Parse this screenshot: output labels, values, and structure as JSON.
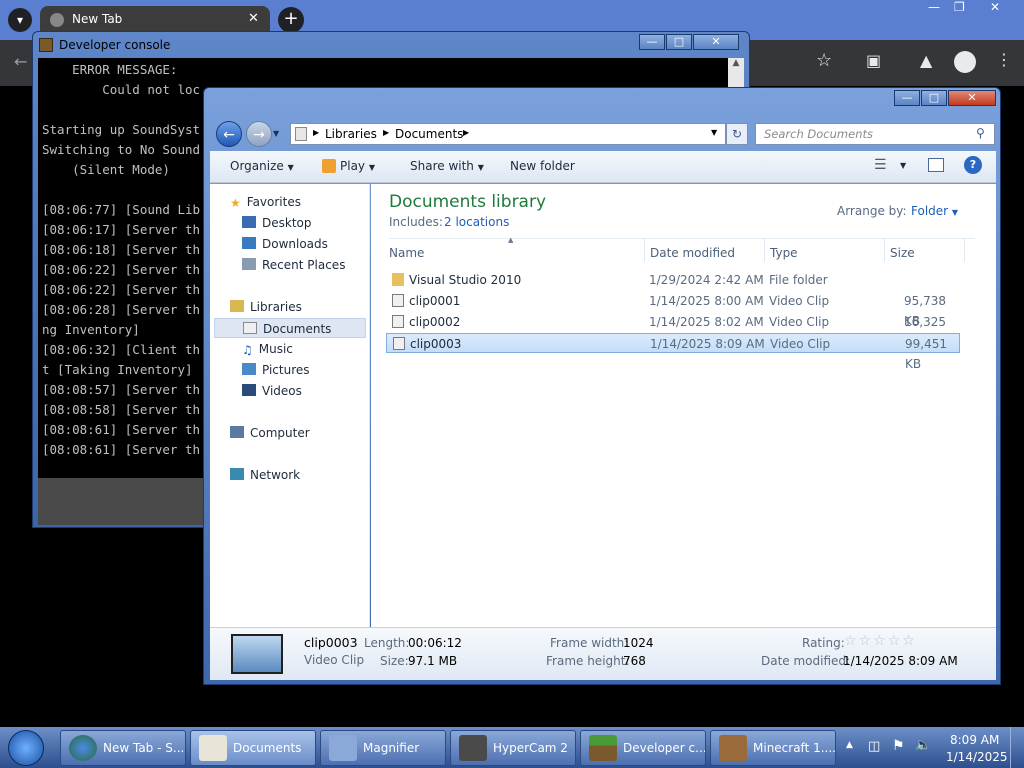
{
  "chrome": {
    "tab_title": "New Tab"
  },
  "console": {
    "title": "Developer console",
    "lines": [
      "    ERROR MESSAGE:",
      "        Could not loc",
      "",
      "Starting up SoundSyst",
      "Switching to No Sound",
      "    (Silent Mode)",
      "",
      "[08:06:77] [Sound Lib",
      "[08:06:17] [Server th",
      "[08:06:18] [Server th",
      "[08:06:22] [Server th",
      "[08:06:22] [Server th",
      "[08:06:28] [Server th",
      "ng Inventory]",
      "[08:06:32] [Client th",
      "t [Taking Inventory]",
      "[08:08:57] [Server th",
      "[08:08:58] [Server th",
      "[08:08:61] [Server th",
      "[08:08:61] [Server th"
    ]
  },
  "explorer": {
    "breadcrumb": [
      "Libraries",
      "Documents"
    ],
    "search_placeholder": "Search Documents",
    "toolbar": {
      "organize": "Organize",
      "play": "Play",
      "share": "Share with",
      "new_folder": "New folder"
    },
    "nav": {
      "favorites": "Favorites",
      "fav_items": [
        "Desktop",
        "Downloads",
        "Recent Places"
      ],
      "libraries": "Libraries",
      "lib_items": [
        "Documents",
        "Music",
        "Pictures",
        "Videos"
      ],
      "computer": "Computer",
      "network": "Network"
    },
    "library_title": "Documents library",
    "includes_label": "Includes:",
    "includes_link": "2 locations",
    "arrange_label": "Arrange by:",
    "arrange_value": "Folder",
    "columns": {
      "name": "Name",
      "date": "Date modified",
      "type": "Type",
      "size": "Size"
    },
    "files": [
      {
        "name": "Visual Studio 2010",
        "date": "1/29/2024 2:42 AM",
        "type": "File folder",
        "size": ""
      },
      {
        "name": "clip0001",
        "date": "1/14/2025 8:00 AM",
        "type": "Video Clip",
        "size": "95,738 KB"
      },
      {
        "name": "clip0002",
        "date": "1/14/2025 8:02 AM",
        "type": "Video Clip",
        "size": "16,325 KB"
      },
      {
        "name": "clip0003",
        "date": "1/14/2025 8:09 AM",
        "type": "Video Clip",
        "size": "99,451 KB"
      }
    ],
    "details": {
      "name": "clip0003",
      "kind": "Video Clip",
      "length_label": "Length:",
      "length": "00:06:12",
      "size_label": "Size:",
      "size": "97.1 MB",
      "fw_label": "Frame width:",
      "fw": "1024",
      "fh_label": "Frame height:",
      "fh": "768",
      "rating_label": "Rating:",
      "dm_label": "Date modified:",
      "dm": "1/14/2025 8:09 AM"
    }
  },
  "taskbar": {
    "items": [
      "New Tab - S...",
      "Documents",
      "Magnifier",
      "HyperCam 2",
      "Developer c...",
      "Minecraft 1...."
    ],
    "time": "8:09 AM",
    "date": "1/14/2025"
  },
  "colors": {
    "accent": "#1a5fb4",
    "title_green": "#1e7a3c",
    "link": "#1f5fb7"
  }
}
